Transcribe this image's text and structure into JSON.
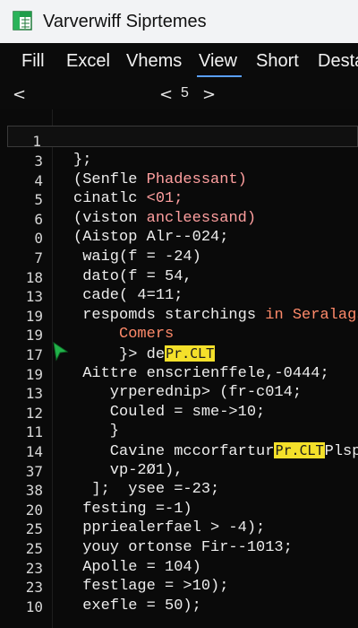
{
  "window": {
    "title": "Varverwiff Siprtemes",
    "icon": "spreadsheet-app-icon"
  },
  "menu": [
    "Fill",
    "Excel",
    "Vhems",
    "View",
    "Short",
    "Desta"
  ],
  "menu_active": "View",
  "nav": {
    "back": "<",
    "prev": "<",
    "page": "5",
    "next": ">"
  },
  "editor": {
    "active_line_number": "1",
    "lines": [
      {
        "n": "3",
        "parts": [
          {
            "t": "};"
          }
        ]
      },
      {
        "n": "4",
        "parts": [
          {
            "t": "(Senfle "
          },
          {
            "t": "Phadessant)",
            "c": "str"
          }
        ]
      },
      {
        "n": "5",
        "parts": [
          {
            "t": "cinatlc "
          },
          {
            "t": "<01;",
            "c": "str"
          }
        ]
      },
      {
        "n": "6",
        "parts": [
          {
            "t": "(viston "
          },
          {
            "t": "ancleessand)",
            "c": "str"
          }
        ]
      },
      {
        "n": "0",
        "parts": [
          {
            "t": "(Aistop Alr--024;"
          }
        ]
      },
      {
        "n": "7",
        "parts": [
          {
            "t": " waig(f = -24)"
          }
        ]
      },
      {
        "n": "18",
        "parts": [
          {
            "t": " dato(f = 54,"
          }
        ]
      },
      {
        "n": "13",
        "parts": [
          {
            "t": " cade( 4=11;"
          }
        ]
      },
      {
        "n": "19",
        "parts": [
          {
            "t": " respomds starchings "
          },
          {
            "t": "in Seralagss",
            "c": "kw"
          }
        ]
      },
      {
        "n": "19",
        "parts": [
          {
            "t": "     "
          },
          {
            "t": "Comers",
            "c": "kw"
          }
        ]
      },
      {
        "n": "17",
        "parts": [
          {
            "t": "     }> de"
          },
          {
            "t": "Pr.CLT",
            "c": "hl"
          }
        ]
      },
      {
        "n": "19",
        "parts": [
          {
            "t": " Aittre enscrienffele,-0444;"
          }
        ]
      },
      {
        "n": "13",
        "parts": [
          {
            "t": "    yrperednip> (fr-c014;"
          }
        ]
      },
      {
        "n": "12",
        "parts": [
          {
            "t": "    Couled = sme->10;"
          }
        ]
      },
      {
        "n": "11",
        "parts": [
          {
            "t": "    }"
          }
        ]
      },
      {
        "n": "14",
        "parts": [
          {
            "t": "    Cavine mccorfartur"
          },
          {
            "t": "Pr.CLT",
            "c": "hl"
          },
          {
            "t": "Plspr"
          }
        ]
      },
      {
        "n": "37",
        "parts": [
          {
            "t": "    vp-2Ø1),"
          }
        ]
      },
      {
        "n": "38",
        "parts": [
          {
            "t": "  ];  ysee =-23;"
          }
        ]
      },
      {
        "n": "20",
        "parts": [
          {
            "t": " festing =-1)"
          }
        ]
      },
      {
        "n": "25",
        "parts": [
          {
            "t": " ppriealerfael > -4);"
          }
        ]
      },
      {
        "n": "25",
        "parts": [
          {
            "t": " youy ortonse Fir--1013;"
          }
        ]
      },
      {
        "n": "23",
        "parts": [
          {
            "t": " Apolle = 104)"
          }
        ]
      },
      {
        "n": "23",
        "parts": [
          {
            "t": " festlage = >10);"
          }
        ]
      },
      {
        "n": "10",
        "parts": [
          {
            "t": " exefle = 50);"
          }
        ]
      }
    ]
  }
}
